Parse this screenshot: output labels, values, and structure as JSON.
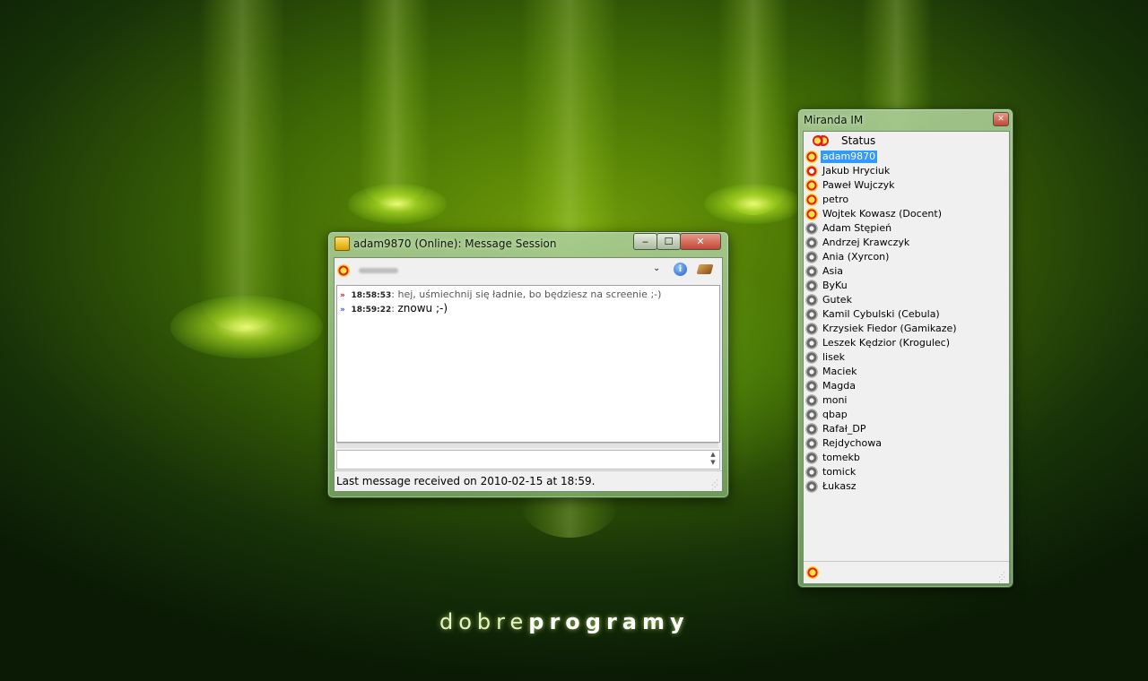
{
  "wallpaper": {
    "brand_light": "dobre",
    "brand_bold": "programy"
  },
  "message_window": {
    "title": "adam9870 (Online): Message Session",
    "caption_buttons": {
      "minimize": "‒",
      "maximize": "☐",
      "close": "✕"
    },
    "toolbar_icons": [
      "contact-status-icon",
      "menu-arrow-icon",
      "info-icon",
      "history-icon"
    ],
    "history": [
      {
        "direction": "in",
        "time": "18:58:53",
        "text": "hej, uśmiechnij się ładnie, bo będziesz na screenie ;-)"
      },
      {
        "direction": "out",
        "time": "18:59:22",
        "text": "znowu ;-)"
      }
    ],
    "input_value": "",
    "status": "Last message received on 2010-02-15 at 18:59."
  },
  "contact_list": {
    "title": "Miranda IM",
    "status_label": "Status",
    "contacts": [
      {
        "name": "adam9870",
        "status": "online",
        "selected": true
      },
      {
        "name": "Jakub Hryciuk",
        "status": "away"
      },
      {
        "name": "Paweł Wujczyk",
        "status": "online"
      },
      {
        "name": "petro",
        "status": "online"
      },
      {
        "name": "Wojtek Kowasz (Docent)",
        "status": "online"
      },
      {
        "name": "Adam Stępień",
        "status": "offline"
      },
      {
        "name": "Andrzej Krawczyk",
        "status": "offline"
      },
      {
        "name": "Ania (Xyrcon)",
        "status": "offline"
      },
      {
        "name": "Asia",
        "status": "offline"
      },
      {
        "name": "ByKu",
        "status": "offline"
      },
      {
        "name": "Gutek",
        "status": "offline"
      },
      {
        "name": "Kamil Cybulski (Cebula)",
        "status": "offline"
      },
      {
        "name": "Krzysiek Fiedor (Gamikaze)",
        "status": "offline"
      },
      {
        "name": "Leszek Kędzior (Krogulec)",
        "status": "offline"
      },
      {
        "name": "lisek",
        "status": "offline"
      },
      {
        "name": "Maciek",
        "status": "offline"
      },
      {
        "name": "Magda",
        "status": "offline"
      },
      {
        "name": "moni",
        "status": "offline"
      },
      {
        "name": "qbap",
        "status": "offline"
      },
      {
        "name": "Rafał_DP",
        "status": "offline"
      },
      {
        "name": "Rejdychowa",
        "status": "offline"
      },
      {
        "name": "tomekb",
        "status": "offline"
      },
      {
        "name": "tomick",
        "status": "offline"
      },
      {
        "name": "Łukasz",
        "status": "offline"
      }
    ]
  },
  "colors": {
    "selection": "#3399ff",
    "incoming_arrow": "#b21b1b",
    "outgoing_arrow": "#2458b8"
  }
}
